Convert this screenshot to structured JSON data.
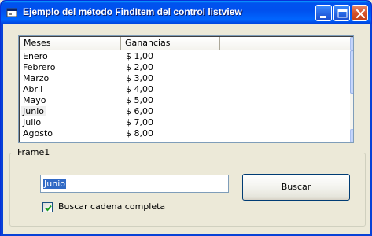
{
  "window": {
    "title": "Ejemplo del método FindItem del control listview",
    "icon": "vb-form-icon"
  },
  "listview": {
    "columns": [
      "Meses",
      "Ganancias",
      ""
    ],
    "rows": [
      {
        "mes": "Enero",
        "ganancia": "$ 1,00"
      },
      {
        "mes": "Febrero",
        "ganancia": "$ 2,00"
      },
      {
        "mes": "Marzo",
        "ganancia": "$ 3,00"
      },
      {
        "mes": "Abril",
        "ganancia": "$ 4,00"
      },
      {
        "mes": "Mayo",
        "ganancia": "$ 5,00"
      },
      {
        "mes": "Junio",
        "ganancia": "$ 6,00"
      },
      {
        "mes": "Julio",
        "ganancia": "$ 7,00"
      },
      {
        "mes": "Agosto",
        "ganancia": "$ 8,00"
      }
    ],
    "selected_row": "Junio"
  },
  "frame": {
    "label": "Frame1",
    "search_value": "Junio",
    "button_label": "Buscar",
    "checkbox_label": "Buscar cadena completa",
    "checkbox_checked": true
  },
  "colors": {
    "titlebar": "#0053ee",
    "selection": "#316ac5",
    "face": "#ece9d8"
  }
}
